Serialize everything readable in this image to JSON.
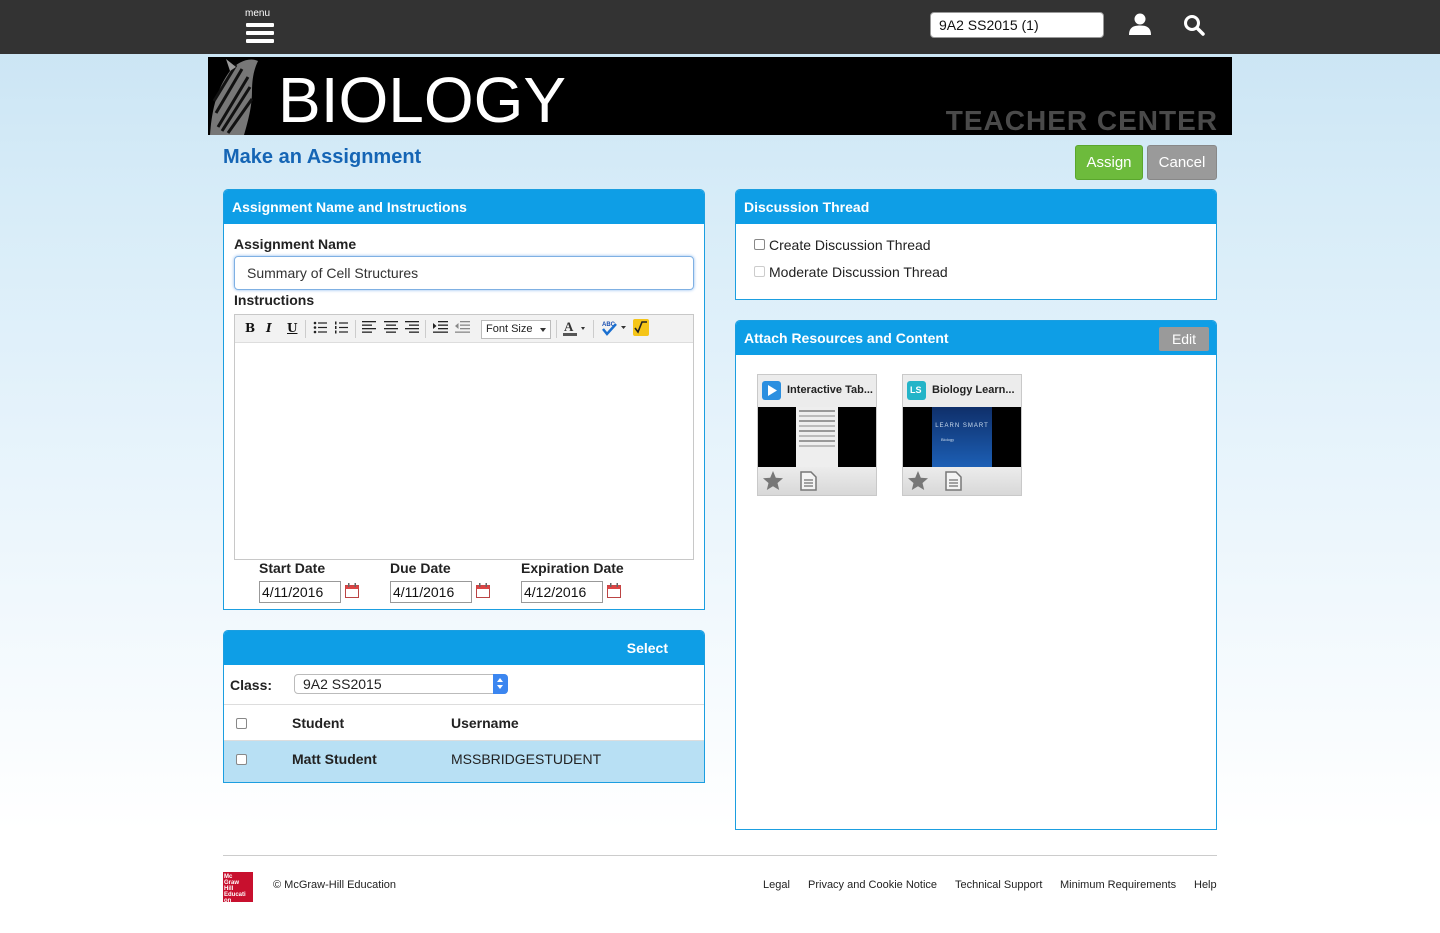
{
  "topbar": {
    "menu_label": "menu",
    "class_selector": "9A2 SS2015 (1)"
  },
  "banner": {
    "title": "BIOLOGY",
    "subtitle": "TEACHER CENTER"
  },
  "page": {
    "title": "Make an Assignment",
    "assign_label": "Assign",
    "cancel_label": "Cancel"
  },
  "assignment": {
    "header": "Assignment Name and Instructions",
    "name_label": "Assignment Name",
    "name_value": "Summary of Cell Structures",
    "instructions_label": "Instructions",
    "font_size_label": "Font Size",
    "start_label": "Start Date",
    "start_value": "4/11/2016",
    "due_label": "Due Date",
    "due_value": "4/11/2016",
    "expiration_label": "Expiration Date",
    "expiration_value": "4/12/2016"
  },
  "discussion": {
    "header": "Discussion Thread",
    "create_label": "Create Discussion Thread",
    "moderate_label": "Moderate Discussion Thread"
  },
  "resources": {
    "header": "Attach Resources and Content",
    "edit_label": "Edit",
    "items": [
      {
        "title": "Interactive Tab..."
      },
      {
        "title": "Biology Learn..."
      }
    ],
    "learnsmart_text": "LEARN SMART",
    "learnsmart_sub": "Biology",
    "ls_badge": "LS"
  },
  "select": {
    "header": "Select",
    "class_label": "Class:",
    "class_value": "9A2 SS2015",
    "col_student": "Student",
    "col_username": "Username",
    "rows": [
      {
        "student": "Matt Student",
        "username": "MSSBRIDGESTUDENT"
      }
    ]
  },
  "footer": {
    "logo_text": "Mc Graw Hill Education",
    "copyright": "© McGraw-Hill Education",
    "links": [
      "Legal",
      "Privacy and Cookie Notice",
      "Technical Support",
      "Minimum Requirements",
      "Help"
    ]
  }
}
